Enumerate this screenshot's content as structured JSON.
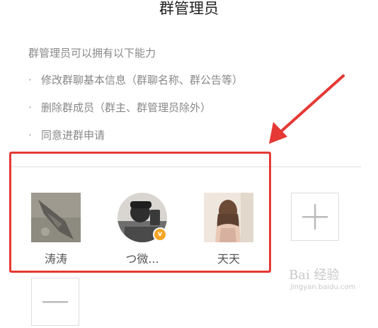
{
  "header": {
    "title": "群管理员"
  },
  "description": {
    "heading": "群管理员可以拥有以下能力",
    "bullet_char": "·",
    "items": [
      "修改群聊基本信息（群聊名称、群公告等）",
      "删除群成员（群主、群管理员除外）",
      "同意进群申请"
    ]
  },
  "admins": [
    {
      "name": "涛涛"
    },
    {
      "name": "つ微..."
    },
    {
      "name": "天天"
    }
  ],
  "verified_badge_char": "v",
  "actions": {
    "add_icon": "plus-icon",
    "remove_icon": "minus-icon"
  },
  "watermark": {
    "brand": "Bai 经验",
    "url": "jingyan.baidu.com"
  },
  "colors": {
    "highlight": "#e53935",
    "badge": "#f5a623"
  }
}
